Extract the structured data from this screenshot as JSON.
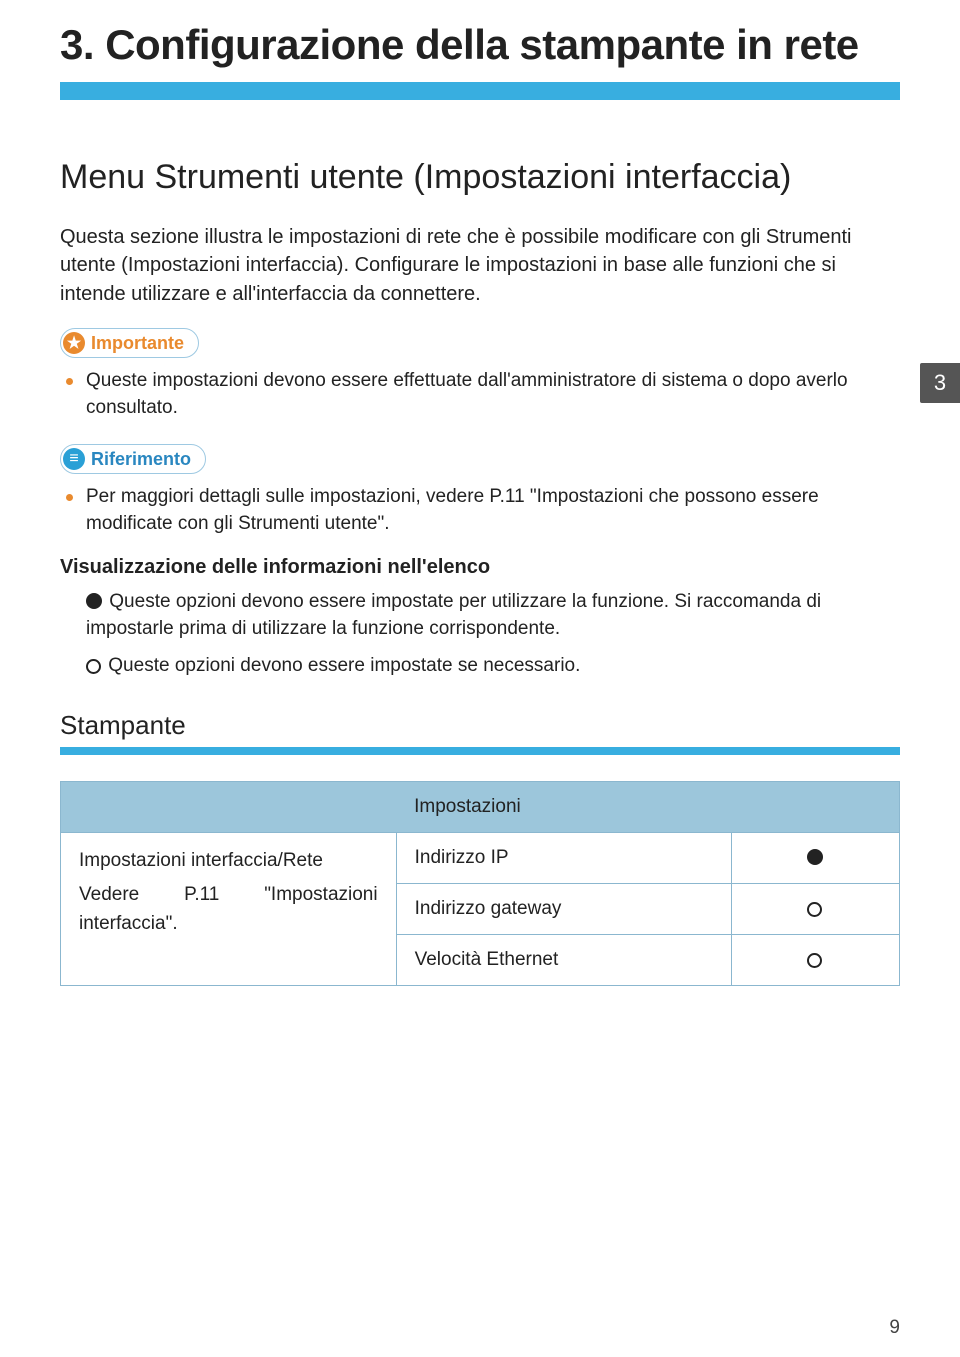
{
  "chapter": {
    "number_title": "3. Configurazione della stampante in rete",
    "tab_number": "3"
  },
  "section": {
    "title": "Menu Strumenti utente (Impostazioni interfaccia)",
    "intro": "Questa sezione illustra le impostazioni di rete che è possibile modificare con gli Strumenti utente (Impostazioni interfaccia). Configurare le impostazioni in base alle funzioni che si intende utilizzare e all'interfaccia da connettere."
  },
  "callouts": {
    "important_label": "Importante",
    "important_item": "Queste impostazioni devono essere effettuate dall'amministratore di sistema o dopo averlo consultato.",
    "reference_label": "Riferimento",
    "reference_item": "Per maggiori dettagli sulle impostazioni, vedere P.11 \"Impostazioni che possono essere modificate con gli Strumenti utente\"."
  },
  "legend": {
    "heading": "Visualizzazione delle informazioni nell'elenco",
    "solid_text": " Queste opzioni devono essere impostate per utilizzare la funzione. Si raccomanda di impostarle prima di utilizzare la funzione corrispondente.",
    "hollow_text": " Queste opzioni devono essere impostate se necessario."
  },
  "subsection": {
    "title": "Stampante"
  },
  "table": {
    "settings_header": "Impostazioni",
    "left_line1": "Impostazioni interfaccia/Rete",
    "left_row2_a": "Vedere",
    "left_row2_b": "P.11",
    "left_row2_c": "\"Impostazioni",
    "left_line3": "interfaccia\".",
    "rows": [
      {
        "name": "Indirizzo IP",
        "mark": "solid"
      },
      {
        "name": "Indirizzo gateway",
        "mark": "hollow"
      },
      {
        "name": "Velocità Ethernet",
        "mark": "hollow"
      }
    ]
  },
  "page_number": "9"
}
